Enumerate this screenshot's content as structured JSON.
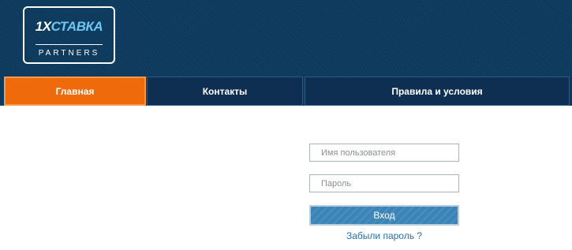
{
  "logo": {
    "brand_prefix": "1X",
    "brand_main": "СТАВКА",
    "subtitle": "PARTNERS"
  },
  "nav": {
    "tabs": [
      {
        "label": "Главная",
        "active": true
      },
      {
        "label": "Контакты",
        "active": false
      },
      {
        "label": "Правила и условия",
        "active": false
      }
    ]
  },
  "login": {
    "username_placeholder": "Имя пользователя",
    "password_placeholder": "Пароль",
    "submit_label": "Вход",
    "forgot_label": "Забыли пароль ?"
  },
  "colors": {
    "header_bg": "#0c3a5e",
    "tab_active": "#ef6a0b",
    "tab_inactive": "#0e2f52",
    "button_bg": "#3a84b8",
    "link": "#2a6fa8"
  }
}
